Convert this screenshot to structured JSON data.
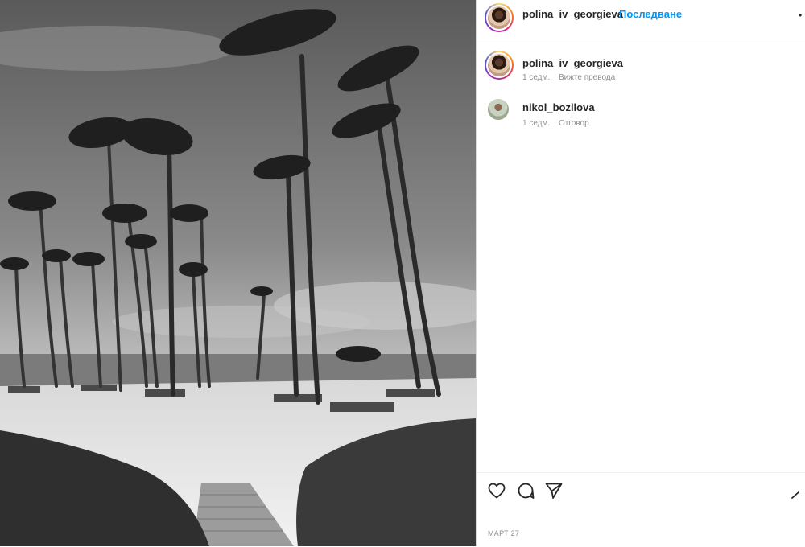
{
  "post": {
    "image_alt": "Black-and-white photo of a tropical beach with tall palm trees, sun loungers, sand and a wooden boardwalk"
  },
  "header": {
    "username": "polina_iv_georgieva",
    "follow_label": "Последване"
  },
  "comments": [
    {
      "username": "polina_iv_georgieva",
      "time": "1 седм.",
      "action": "Вижте превода"
    },
    {
      "username": "nikol_bozilova",
      "time": "1 седм.",
      "action": "Отговор"
    }
  ],
  "footer": {
    "date": "МАРТ 27"
  },
  "icons": {
    "like": "heart-icon",
    "comment": "comment-icon",
    "share": "share-icon",
    "save": "bookmark-icon",
    "more": "more-options-icon"
  },
  "colors": {
    "accent": "#0095f6",
    "text": "#262626",
    "muted": "#8e8e8e",
    "border": "#dbdbdb"
  }
}
